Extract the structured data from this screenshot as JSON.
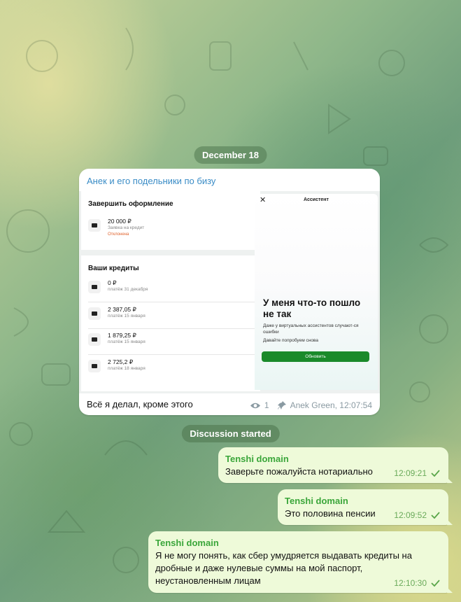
{
  "date_pill": "December 18",
  "discussion_pill": "Discussion started",
  "post": {
    "channel": "Анек и его подельники по бизу",
    "caption": "Всё я делал, кроме этого",
    "views": "1",
    "author_time": "Anek Green, 12:07:54",
    "screenshot": {
      "finish_title": "Завершить оформление",
      "pending": {
        "amount": "20 000 ₽",
        "sub": "Заявка на кредит",
        "status": "Отклонена"
      },
      "credits_title": "Ваши кредиты",
      "credits": [
        {
          "amount": "0 ₽",
          "sub": "платёж 31 декабря"
        },
        {
          "amount": "2 387,05 ₽",
          "sub": "платёж 15 января"
        },
        {
          "amount": "1 879,25 ₽",
          "sub": "платёж 15 января"
        },
        {
          "amount": "2 725,2 ₽",
          "sub": "платёж 18 января"
        }
      ],
      "assistant": {
        "close": "✕",
        "title": "Ассистент",
        "headline": "У меня что-то пошло не так",
        "desc": "Даже у виртуальных ассистентов случают-ся ошибки",
        "desc2": "Давайте попробуем снова",
        "button": "Обновить"
      }
    }
  },
  "messages": [
    {
      "author": "Tenshi domain",
      "text": "Заверьте пожалуйста нотариально",
      "time": "12:09:21"
    },
    {
      "author": "Tenshi domain",
      "text": "Это половина пенсии",
      "time": "12:09:52"
    },
    {
      "author": "Tenshi domain",
      "text": "Я не могу понять, как сбер умудряется выдавать кредиты на дробные и даже нулевые суммы на мой паспорт, неустановленным лицам",
      "time": "12:10:30"
    }
  ]
}
